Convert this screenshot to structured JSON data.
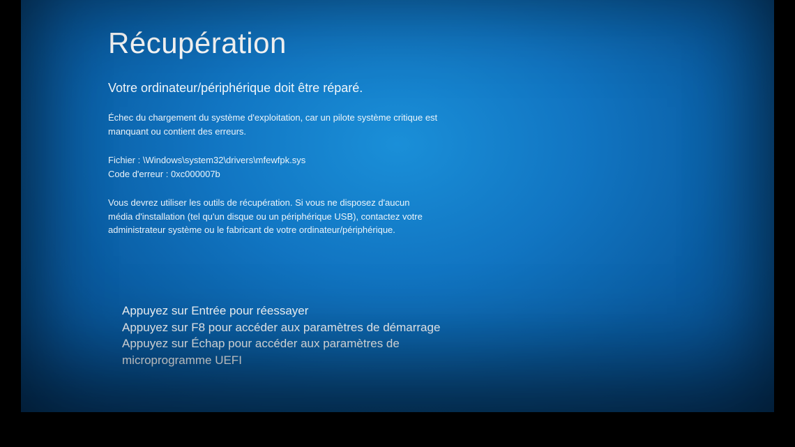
{
  "title": "Récupération",
  "subtitle": "Votre ordinateur/périphérique doit être réparé.",
  "errorMessage": "Échec du chargement du système d'exploitation, car un pilote système critique est manquant ou contient des erreurs.",
  "file": {
    "label": "Fichier :",
    "path": "\\Windows\\system32\\drivers\\mfewfpk.sys"
  },
  "errorCode": {
    "label": "Code d'erreur :",
    "value": "0xc000007b"
  },
  "instruction": "Vous devrez utiliser les outils de récupération. Si vous ne disposez d'aucun média d'installation (tel qu'un disque ou un périphérique USB), contactez votre administrateur système ou le fabricant de votre ordinateur/périphérique.",
  "keyPrompts": {
    "enter": "Appuyez sur Entrée pour réessayer",
    "f8": "Appuyez sur F8 pour accéder aux paramètres de démarrage",
    "esc": "Appuyez sur Échap pour accéder aux paramètres de microprogramme UEFI"
  }
}
